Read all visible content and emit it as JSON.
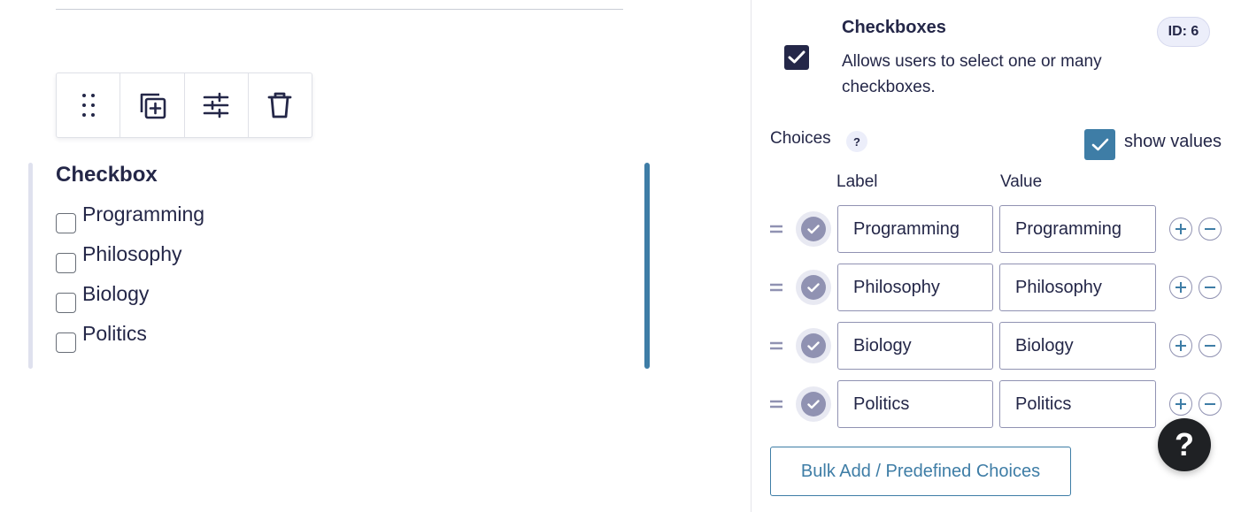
{
  "editor": {
    "field_label": "Checkbox",
    "options": [
      "Programming",
      "Philosophy",
      "Biology",
      "Politics"
    ],
    "toolbar_icons": [
      "drag-handle-icon",
      "duplicate-icon",
      "settings-sliders-icon",
      "trash-icon"
    ]
  },
  "panel": {
    "field_type_title": "Checkboxes",
    "field_type_desc": "Allows users to select one or many checkboxes.",
    "id_badge": "ID: 6",
    "choices_title": "Choices",
    "help_mark": "?",
    "show_values_label": "show values",
    "show_values_checked": true,
    "col_label": "Label",
    "col_value": "Value",
    "choices": [
      {
        "label": "Programming",
        "value": "Programming"
      },
      {
        "label": "Philosophy",
        "value": "Philosophy"
      },
      {
        "label": "Biology",
        "value": "Biology"
      },
      {
        "label": "Politics",
        "value": "Politics"
      }
    ],
    "bulk_button": "Bulk Add / Predefined Choices"
  },
  "help_fab": "?",
  "colors": {
    "accent": "#3e7da6",
    "dark": "#242748",
    "muted": "#9092b2"
  }
}
